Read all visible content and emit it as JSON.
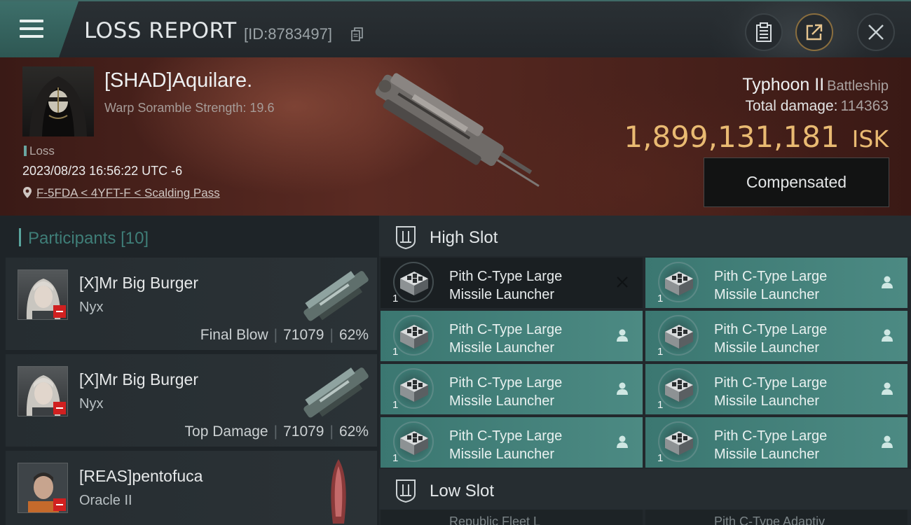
{
  "header": {
    "title": "LOSS REPORT",
    "report_id": "[ID:8783497]",
    "icons": [
      "menu-icon",
      "copy-icon",
      "clipboard-icon",
      "share-icon",
      "close-icon"
    ]
  },
  "victim": {
    "pilot": "[SHAD]Aquilare.",
    "warp_scramble": "Warp Soramble Strength: 19.6",
    "tag": "Loss",
    "datetime": "2023/08/23 16:56:22 UTC -6",
    "location": "F-5FDA < 4YFT-F < Scalding Pass",
    "ship_name": "Typhoon II",
    "ship_class": "Battleship",
    "damage_label": "Total damage:",
    "damage_value": "114363",
    "isk_value": "1,899,131,181",
    "isk_unit": "ISK",
    "status_button": "Compensated"
  },
  "participants": {
    "title": "Participants",
    "count": "[10]",
    "rows": [
      {
        "name": "[X]Mr Big Burger",
        "ship": "Nyx",
        "label": "Final Blow",
        "damage": "71079",
        "percent": "62%"
      },
      {
        "name": "[X]Mr Big Burger",
        "ship": "Nyx",
        "label": "Top Damage",
        "damage": "71079",
        "percent": "62%"
      },
      {
        "name": "[REAS]pentofuca",
        "ship": "Oracle II",
        "label": "",
        "damage": "",
        "percent": ""
      }
    ]
  },
  "slots": {
    "high_label": "High Slot",
    "low_label": "Low Slot",
    "high_items": [
      {
        "line1": "Pith C-Type Large",
        "line2": "Missile Launcher",
        "qty": "1",
        "state": "destroyed"
      },
      {
        "line1": "Pith C-Type Large",
        "line2": "Missile Launcher",
        "qty": "1",
        "state": "dropped"
      },
      {
        "line1": "Pith C-Type Large",
        "line2": "Missile Launcher",
        "qty": "1",
        "state": "dropped"
      },
      {
        "line1": "Pith C-Type Large",
        "line2": "Missile Launcher",
        "qty": "1",
        "state": "dropped"
      },
      {
        "line1": "Pith C-Type Large",
        "line2": "Missile Launcher",
        "qty": "1",
        "state": "dropped"
      },
      {
        "line1": "Pith C-Type Large",
        "line2": "Missile Launcher",
        "qty": "1",
        "state": "dropped"
      },
      {
        "line1": "Pith C-Type Large",
        "line2": "Missile Launcher",
        "qty": "1",
        "state": "dropped"
      },
      {
        "line1": "Pith C-Type Large",
        "line2": "Missile Launcher",
        "qty": "1",
        "state": "dropped"
      }
    ],
    "low_items_partial": [
      "Republic Fleet L",
      "Pith C-Type Adaptiv"
    ]
  },
  "colors": {
    "accent_teal": "#3b7771",
    "isk_gold": "#e9ba72",
    "loss_red": "#d02020"
  }
}
